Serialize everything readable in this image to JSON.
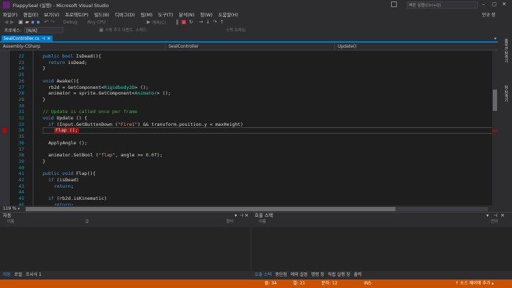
{
  "window": {
    "title": "FlappySeal (실행) - Microsoft Visual Studio"
  },
  "quick_launch": {
    "placeholder": "빠른 실행(Ctrl+Q)"
  },
  "menu": [
    "파일(F)",
    "편집(E)",
    "보기(V)",
    "프로젝트(P)",
    "빌드(B)",
    "디버그(D)",
    "팀(M)",
    "도구(T)",
    "분석(N)",
    "창(W)",
    "도움말(H)"
  ],
  "account": {
    "name": "민규 정"
  },
  "toolbar": {
    "config": "Debug",
    "platform": "Any CPU",
    "continue_label": "계속(C)"
  },
  "toolbar2": {
    "process_label": "프로세스:",
    "process_value": "[N/A]",
    "events_label": "수명 주기 이벤트",
    "thread_label": "스레드:",
    "stack_label": "스택 프레임:"
  },
  "doc_tab": {
    "label": "SealController.cs"
  },
  "nav": {
    "project": "Assembly-CSharp",
    "class": "SealController",
    "member": "Update()"
  },
  "code_lines": [
    {
      "n": "22",
      "html": "<span class='kw'>public</span> <span class='kw'>bool</span> <span class='tx'>IsDead(){</span>",
      "indent": 0
    },
    {
      "n": "23",
      "html": "<span class='kw'>return</span> <span class='tx'>isDead;</span>",
      "indent": 2
    },
    {
      "n": "24",
      "html": "<span class='tx'>}</span>",
      "indent": 0
    },
    {
      "n": "25",
      "html": "",
      "indent": 0
    },
    {
      "n": "26",
      "html": "<span class='kw'>void</span> <span class='tx'>Awake(){</span>",
      "indent": 0
    },
    {
      "n": "27",
      "html": "<span class='tx'>rb2d = GetComponent&lt;</span><span class='ty'>Rigidbody2D</span><span class='tx'>&gt; ();</span>",
      "indent": 2
    },
    {
      "n": "28",
      "html": "<span class='tx'>animator = sprite.GetComponent&lt;</span><span class='ty'>Animator</span><span class='tx'>&gt; ();</span>",
      "indent": 2
    },
    {
      "n": "29",
      "html": "<span class='tx'>}</span>",
      "indent": 0
    },
    {
      "n": "30",
      "html": "",
      "indent": 0
    },
    {
      "n": "31",
      "html": "<span class='cm'>// Update is called once per frame</span>",
      "indent": 0
    },
    {
      "n": "32",
      "html": "<span class='kw'>void</span> <span class='tx'>Update () {</span>",
      "indent": 0
    },
    {
      "n": "33",
      "html": "<span class='kw'>if</span> <span class='tx'>(Input.GetButtonDown (</span><span class='st'>\"Fire1\"</span><span class='tx'>) &amp;&amp; transform.position.y &lt; maxHeight)</span>",
      "indent": 2
    },
    {
      "n": "34",
      "html": "<span class='tx'>Flap ();</span>",
      "indent": 4
    },
    {
      "n": "35",
      "html": "",
      "indent": 0
    },
    {
      "n": "36",
      "html": "<span class='tx'>ApplyAngle ();</span>",
      "indent": 2
    },
    {
      "n": "37",
      "html": "",
      "indent": 0
    },
    {
      "n": "38",
      "html": "<span class='tx'>animator.SetBool (</span><span class='st'>\"flap\"</span><span class='tx'>, angle &gt;= </span><span class='nm'>0.0f</span><span class='tx'>);</span>",
      "indent": 2
    },
    {
      "n": "39",
      "html": "<span class='tx'>}</span>",
      "indent": 0
    },
    {
      "n": "40",
      "html": "",
      "indent": 0
    },
    {
      "n": "41",
      "html": "<span class='kw'>public</span> <span class='kw'>void</span> <span class='tx'>Flap(){</span>",
      "indent": 0
    },
    {
      "n": "42",
      "html": "<span class='kw'>if</span> <span class='tx'>(isDead)</span>",
      "indent": 2
    },
    {
      "n": "43",
      "html": "<span class='kw'>return</span><span class='tx'>;</span>",
      "indent": 4
    },
    {
      "n": "44",
      "html": "",
      "indent": 0
    },
    {
      "n": "45",
      "html": "<span class='kw'>if</span> <span class='tx'>(rb2d.isKinematic)</span>",
      "indent": 2
    },
    {
      "n": "46",
      "html": "<span class='kw'>return</span><span class='tx'>;</span>",
      "indent": 4
    }
  ],
  "breakpoint_line": "34",
  "zoom": "119 %",
  "autos": {
    "title": "자동",
    "col_name": "이름",
    "col_value": "값",
    "col_type": "형식",
    "tabs": [
      "자동",
      "로컬",
      "조사식 1"
    ]
  },
  "callstack": {
    "title": "호출 스택",
    "col_name": "이름",
    "col_lang": "언어",
    "tabs": [
      "호출 스택",
      "중단점",
      "예외 설정",
      "명령 창",
      "직접 실행 창",
      "출력"
    ]
  },
  "status": {
    "line": "줄: 34",
    "col": "열: 21",
    "ch": "문자: 12",
    "mode": "INS",
    "scm": "↑ 소스 제어에 추가 ▴"
  },
  "rail": {
    "label1": "솔루션 탐색기",
    "label2": "팀 탐색기"
  },
  "colors": {
    "accent": "#007acc",
    "status": "#ca5100",
    "breakpoint": "#c50000"
  }
}
